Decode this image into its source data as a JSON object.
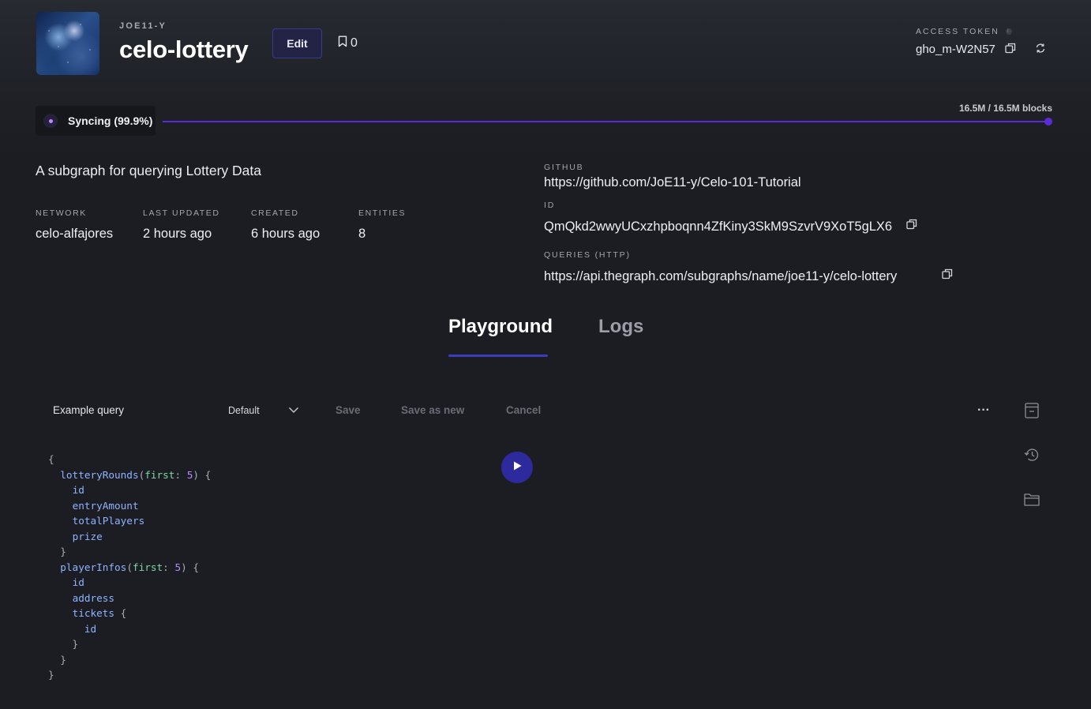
{
  "subgraph": {
    "owner": "JOE11-Y",
    "name": "celo-lottery",
    "edit_label": "Edit",
    "bookmark_count": "0"
  },
  "access_token": {
    "label": "ACCESS TOKEN",
    "value": "gho_m-W2N57"
  },
  "sync": {
    "status": "Syncing (99.9%)",
    "progress_percent": 99.9,
    "blocks": "16.5M / 16.5M blocks"
  },
  "description": "A subgraph for querying Lottery Data",
  "meta": [
    {
      "label": "NETWORK",
      "value": "celo-alfajores"
    },
    {
      "label": "LAST UPDATED",
      "value": "2 hours ago"
    },
    {
      "label": "CREATED",
      "value": "6 hours ago"
    },
    {
      "label": "ENTITIES",
      "value": "8"
    }
  ],
  "links": {
    "github_label": "GITHUB",
    "github_value": "https://github.com/JoE11-y/Celo-101-Tutorial",
    "id_label": "ID",
    "id_value": "QmQkd2wwyUCxzhpboqnn4ZfKiny3SkM9SzvrV9XoT5gLX6",
    "queries_label": "QUERIES (HTTP)",
    "queries_value": "https://api.thegraph.com/subgraphs/name/joe11-y/celo-lottery"
  },
  "tabs": [
    {
      "label": "Playground",
      "active": true
    },
    {
      "label": "Logs",
      "active": false
    }
  ],
  "toolbar": {
    "query_name": "Example query",
    "select_value": "Default",
    "save": "Save",
    "save_as_new": "Save as new",
    "cancel": "Cancel",
    "more": "···"
  },
  "code_lines": [
    "{",
    "  lotteryRounds(first: 5) {",
    "    id",
    "    entryAmount",
    "    totalPlayers",
    "    prize",
    "  }",
    "  playerInfos(first: 5) {",
    "    id",
    "    address",
    "    tickets {",
    "      id",
    "    }",
    "  }",
    "}"
  ],
  "colors": {
    "accent": "#5a2bd6",
    "run_button": "#2d2a9e",
    "background": "#1c1d23"
  },
  "icons": [
    "bookmark-icon",
    "copy-icon",
    "refresh-icon",
    "info-icon",
    "chevron-down-icon",
    "more-icon",
    "document-icon",
    "history-icon",
    "folder-add-icon",
    "play-icon",
    "sync-dot-icon"
  ]
}
